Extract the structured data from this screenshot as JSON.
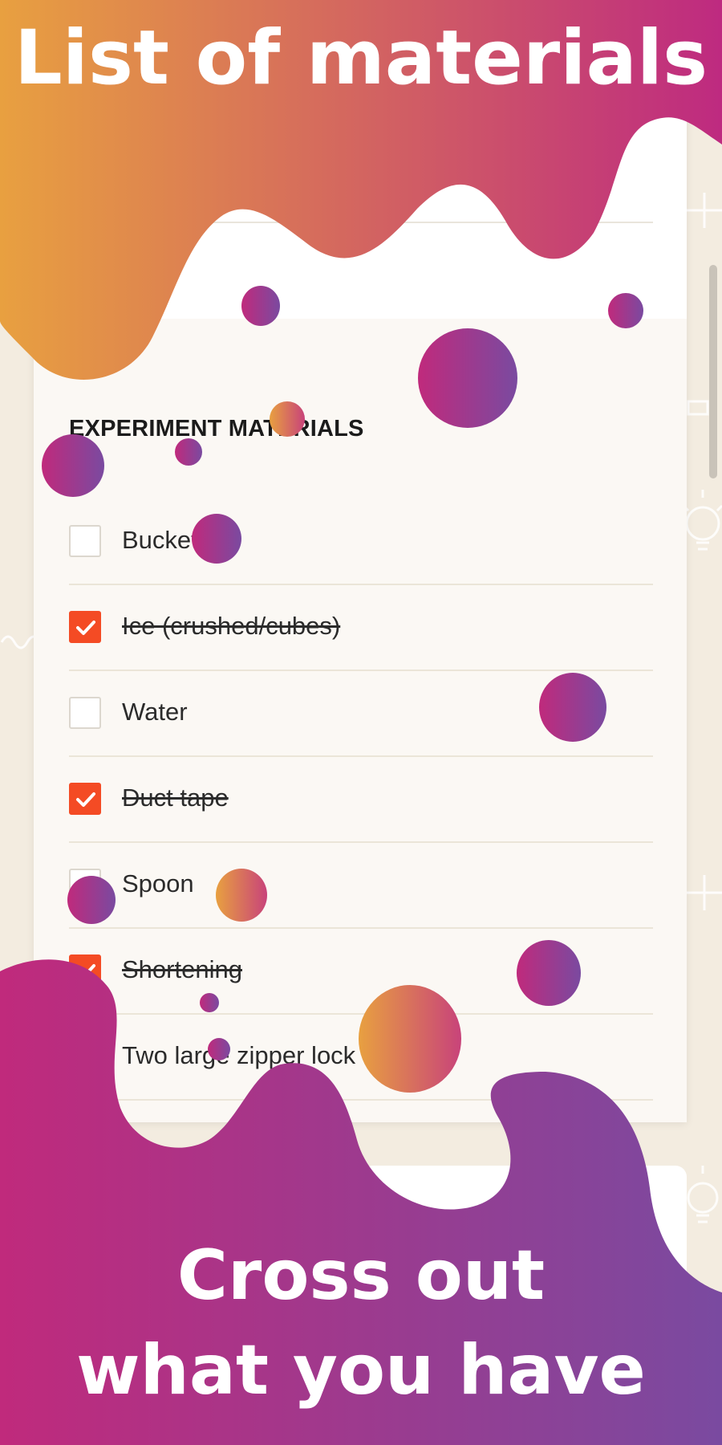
{
  "colors": {
    "accent": "#f44b24",
    "gradient_orange": "#e8a040",
    "gradient_magenta": "#c02a7c",
    "gradient_purple": "#7a4aa0",
    "background": "#f3ece0"
  },
  "promo": {
    "headline_top": "List of materials",
    "headline_bottom_line1": "Cross out",
    "headline_bottom_line2": "what you have"
  },
  "section": {
    "heading": "EXPERIMENT MATERIALS"
  },
  "materials": [
    {
      "label": "Bucket",
      "checked": false
    },
    {
      "label": "Ice (crushed/cubes)",
      "checked": true
    },
    {
      "label": "Water",
      "checked": false
    },
    {
      "label": "Duct tape",
      "checked": true
    },
    {
      "label": "Spoon",
      "checked": false
    },
    {
      "label": "Shortening",
      "checked": true
    },
    {
      "label": "Two large zipper lock",
      "checked": false
    }
  ],
  "icons": [
    "check-icon",
    "plus-icon",
    "lightbulb-icon"
  ]
}
